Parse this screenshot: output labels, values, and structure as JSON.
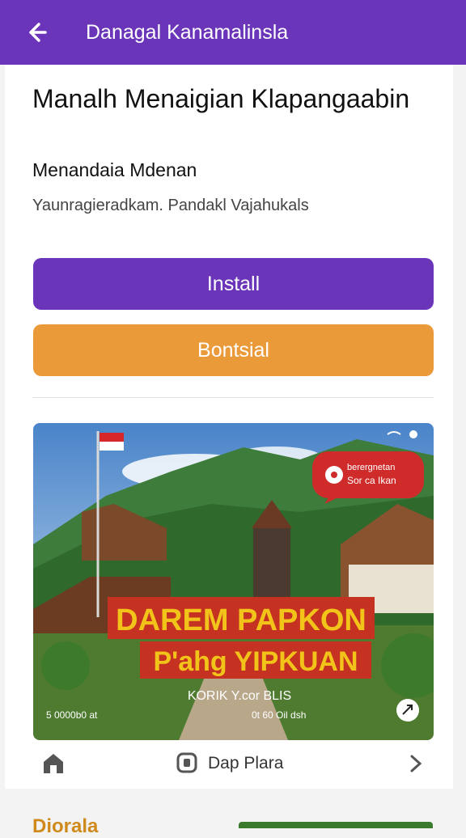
{
  "header": {
    "title": "Danagal Kanamalinsla"
  },
  "main": {
    "heading": "Manalh Menaigian Klapangaabin",
    "subheading": "Menandaia Mdenan",
    "description": "Yaunragieradkam. Pandakl Vajahukals",
    "install_label": "Install",
    "secondary_label": "Bontsial"
  },
  "media": {
    "badge_line1": "berergnetan",
    "badge_line2": "Sor ca Ikan",
    "banner_line1": "DAREM PAPKON",
    "banner_line2": "P'ahg YIPKUAN",
    "small_title": "KORIK Y.cor BLIS",
    "caption_left": "5 0000b0 at",
    "caption_right": "0t 60 Oil dsh"
  },
  "footer": {
    "app_name": "Dap Plara"
  },
  "bottom": {
    "partial_text": "Diorala"
  },
  "colors": {
    "primary": "#6a35b9",
    "secondary": "#eb9a3a",
    "badge": "#cf2b2b"
  }
}
